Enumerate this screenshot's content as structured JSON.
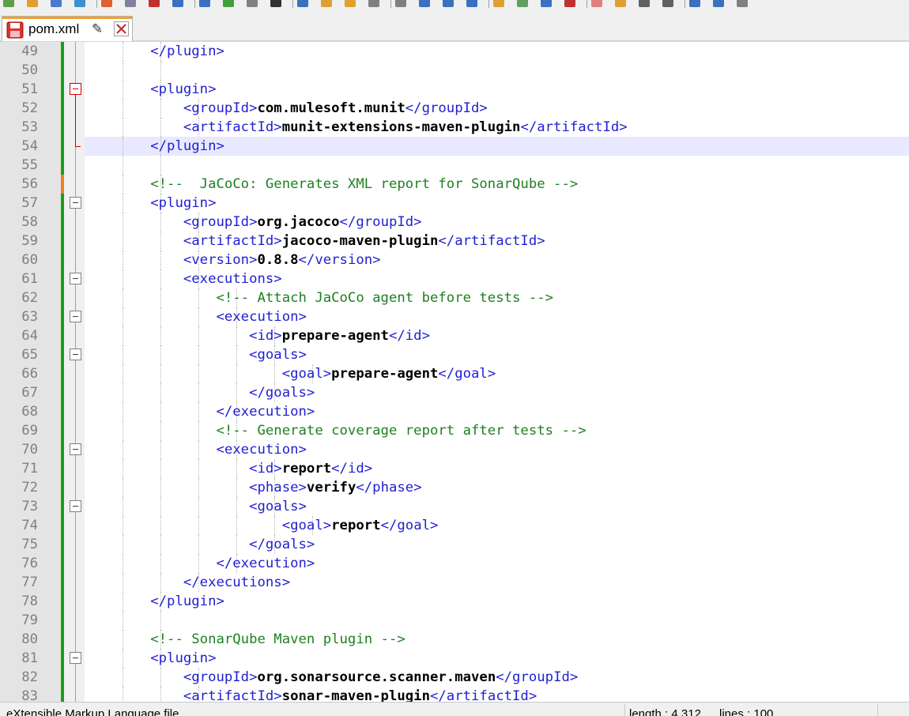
{
  "tab": {
    "filename": "pom.xml"
  },
  "colors": {
    "tag": "#1f1fd2",
    "value": "#000000",
    "comment": "#208020",
    "change_saved": "#18a018",
    "change_unsaved": "#f08020",
    "caret_line": "#e8e8ff"
  },
  "lines": [
    {
      "num": "49",
      "guides": [
        1,
        2
      ],
      "tokens": [
        {
          "k": "t",
          "s": "        </plugin>"
        }
      ]
    },
    {
      "num": "50",
      "guides": [
        1,
        2
      ],
      "tokens": []
    },
    {
      "num": "51",
      "guides": [
        1,
        2
      ],
      "tokens": [
        {
          "k": "t",
          "s": "        <plugin>"
        }
      ]
    },
    {
      "num": "52",
      "guides": [
        1,
        2,
        3
      ],
      "tokens": [
        {
          "k": "t",
          "s": "            <groupId>"
        },
        {
          "k": "v",
          "s": "com.mulesoft.munit"
        },
        {
          "k": "t",
          "s": "</groupId>"
        }
      ]
    },
    {
      "num": "53",
      "guides": [
        1,
        2,
        3
      ],
      "tokens": [
        {
          "k": "t",
          "s": "            <artifactId>"
        },
        {
          "k": "v",
          "s": "munit-extensions-maven-plugin"
        },
        {
          "k": "t",
          "s": "</artifactId>"
        }
      ]
    },
    {
      "num": "54",
      "guides": [
        1,
        2
      ],
      "tokens": [
        {
          "k": "t",
          "s": "        </plugin>"
        }
      ]
    },
    {
      "num": "55",
      "guides": [
        1,
        2
      ],
      "tokens": []
    },
    {
      "num": "56",
      "guides": [
        1,
        2
      ],
      "tokens": [
        {
          "k": "c",
          "s": "        <!--  JaCoCo: Generates XML report for SonarQube -->"
        }
      ]
    },
    {
      "num": "57",
      "guides": [
        1,
        2
      ],
      "tokens": [
        {
          "k": "t",
          "s": "        <plugin>"
        }
      ]
    },
    {
      "num": "58",
      "guides": [
        1,
        2,
        3
      ],
      "tokens": [
        {
          "k": "t",
          "s": "            <groupId>"
        },
        {
          "k": "v",
          "s": "org.jacoco"
        },
        {
          "k": "t",
          "s": "</groupId>"
        }
      ]
    },
    {
      "num": "59",
      "guides": [
        1,
        2,
        3
      ],
      "tokens": [
        {
          "k": "t",
          "s": "            <artifactId>"
        },
        {
          "k": "v",
          "s": "jacoco-maven-plugin"
        },
        {
          "k": "t",
          "s": "</artifactId>"
        }
      ]
    },
    {
      "num": "60",
      "guides": [
        1,
        2,
        3
      ],
      "tokens": [
        {
          "k": "t",
          "s": "            <version>"
        },
        {
          "k": "v",
          "s": "0.8.8"
        },
        {
          "k": "t",
          "s": "</version>"
        }
      ]
    },
    {
      "num": "61",
      "guides": [
        1,
        2,
        3
      ],
      "tokens": [
        {
          "k": "t",
          "s": "            <executions>"
        }
      ]
    },
    {
      "num": "62",
      "guides": [
        1,
        2,
        3,
        4
      ],
      "tokens": [
        {
          "k": "c",
          "s": "                <!-- Attach JaCoCo agent before tests -->"
        }
      ]
    },
    {
      "num": "63",
      "guides": [
        1,
        2,
        3,
        4
      ],
      "tokens": [
        {
          "k": "t",
          "s": "                <execution>"
        }
      ]
    },
    {
      "num": "64",
      "guides": [
        1,
        2,
        3,
        4,
        5
      ],
      "tokens": [
        {
          "k": "t",
          "s": "                    <id>"
        },
        {
          "k": "v",
          "s": "prepare-agent"
        },
        {
          "k": "t",
          "s": "</id>"
        }
      ]
    },
    {
      "num": "65",
      "guides": [
        1,
        2,
        3,
        4,
        5
      ],
      "tokens": [
        {
          "k": "t",
          "s": "                    <goals>"
        }
      ]
    },
    {
      "num": "66",
      "guides": [
        1,
        2,
        3,
        4,
        5,
        6
      ],
      "tokens": [
        {
          "k": "t",
          "s": "                        <goal>"
        },
        {
          "k": "v",
          "s": "prepare-agent"
        },
        {
          "k": "t",
          "s": "</goal>"
        }
      ]
    },
    {
      "num": "67",
      "guides": [
        1,
        2,
        3,
        4,
        5
      ],
      "tokens": [
        {
          "k": "t",
          "s": "                    </goals>"
        }
      ]
    },
    {
      "num": "68",
      "guides": [
        1,
        2,
        3,
        4
      ],
      "tokens": [
        {
          "k": "t",
          "s": "                </execution>"
        }
      ]
    },
    {
      "num": "69",
      "guides": [
        1,
        2,
        3,
        4
      ],
      "tokens": [
        {
          "k": "c",
          "s": "                <!-- Generate coverage report after tests -->"
        }
      ]
    },
    {
      "num": "70",
      "guides": [
        1,
        2,
        3,
        4
      ],
      "tokens": [
        {
          "k": "t",
          "s": "                <execution>"
        }
      ]
    },
    {
      "num": "71",
      "guides": [
        1,
        2,
        3,
        4,
        5
      ],
      "tokens": [
        {
          "k": "t",
          "s": "                    <id>"
        },
        {
          "k": "v",
          "s": "report"
        },
        {
          "k": "t",
          "s": "</id>"
        }
      ]
    },
    {
      "num": "72",
      "guides": [
        1,
        2,
        3,
        4,
        5
      ],
      "tokens": [
        {
          "k": "t",
          "s": "                    <phase>"
        },
        {
          "k": "v",
          "s": "verify"
        },
        {
          "k": "t",
          "s": "</phase>"
        }
      ]
    },
    {
      "num": "73",
      "guides": [
        1,
        2,
        3,
        4,
        5
      ],
      "tokens": [
        {
          "k": "t",
          "s": "                    <goals>"
        }
      ]
    },
    {
      "num": "74",
      "guides": [
        1,
        2,
        3,
        4,
        5,
        6
      ],
      "tokens": [
        {
          "k": "t",
          "s": "                        <goal>"
        },
        {
          "k": "v",
          "s": "report"
        },
        {
          "k": "t",
          "s": "</goal>"
        }
      ]
    },
    {
      "num": "75",
      "guides": [
        1,
        2,
        3,
        4,
        5
      ],
      "tokens": [
        {
          "k": "t",
          "s": "                    </goals>"
        }
      ]
    },
    {
      "num": "76",
      "guides": [
        1,
        2,
        3,
        4
      ],
      "tokens": [
        {
          "k": "t",
          "s": "                </execution>"
        }
      ]
    },
    {
      "num": "77",
      "guides": [
        1,
        2,
        3
      ],
      "tokens": [
        {
          "k": "t",
          "s": "            </executions>"
        }
      ]
    },
    {
      "num": "78",
      "guides": [
        1,
        2
      ],
      "tokens": [
        {
          "k": "t",
          "s": "        </plugin>"
        }
      ]
    },
    {
      "num": "79",
      "guides": [
        1,
        2
      ],
      "tokens": []
    },
    {
      "num": "80",
      "guides": [
        1,
        2
      ],
      "tokens": [
        {
          "k": "c",
          "s": "        <!-- SonarQube Maven plugin -->"
        }
      ]
    },
    {
      "num": "81",
      "guides": [
        1,
        2
      ],
      "tokens": [
        {
          "k": "t",
          "s": "        <plugin>"
        }
      ]
    },
    {
      "num": "82",
      "guides": [
        1,
        2,
        3
      ],
      "tokens": [
        {
          "k": "t",
          "s": "            <groupId>"
        },
        {
          "k": "v",
          "s": "org.sonarsource.scanner.maven"
        },
        {
          "k": "t",
          "s": "</groupId>"
        }
      ]
    },
    {
      "num": "83",
      "guides": [
        1,
        2,
        3
      ],
      "tokens": [
        {
          "k": "t",
          "s": "            <artifactId>"
        },
        {
          "k": "v",
          "s": "sonar-maven-plugin"
        },
        {
          "k": "t",
          "s": "</artifactId>"
        }
      ]
    }
  ],
  "fold_markers": [
    {
      "line": "51",
      "type": "open",
      "highlight": true
    },
    {
      "line": "54",
      "type": "end",
      "highlight": true
    },
    {
      "line": "57",
      "type": "open"
    },
    {
      "line": "61",
      "type": "open"
    },
    {
      "line": "63",
      "type": "open"
    },
    {
      "line": "65",
      "type": "open"
    },
    {
      "line": "70",
      "type": "open"
    },
    {
      "line": "73",
      "type": "open"
    },
    {
      "line": "81",
      "type": "open"
    }
  ],
  "statusbar": {
    "file_type": "eXtensible Markup Language file",
    "length": "length : 4,312",
    "lines": "lines : 100"
  }
}
